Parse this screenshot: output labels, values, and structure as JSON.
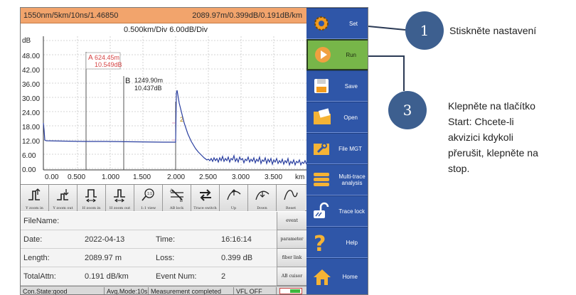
{
  "header": {
    "params_left": "1550nm/5km/10ns/1.46850",
    "params_right": "2089.97m/0.399dB/0.191dB/km"
  },
  "plot": {
    "y_unit": "dB",
    "scale_text": "0.500km/Div  6.00dB/Div",
    "y_ticks": [
      "48.00",
      "42.00",
      "36.00",
      "30.00",
      "24.00",
      "18.00",
      "12.00",
      "6.00",
      "0.00"
    ],
    "x_ticks": [
      "0.00",
      "0.500",
      "1.000",
      "1.500",
      "2.000",
      "2.500",
      "3.000",
      "3.500"
    ],
    "x_unit": "km",
    "marker_a_letter": "A",
    "marker_a_distance": "624.45m",
    "marker_a_loss": "10.549dB",
    "marker_b_letter": "B",
    "marker_b_distance": "1249.90m",
    "marker_b_loss": "10.437dB",
    "event_number": "2",
    "colors": {
      "trace": "#2a3fa0",
      "marker_a": "#d64545",
      "event": "#e0a0c0"
    }
  },
  "toolbar": {
    "tools": [
      {
        "label": "Y zoom in",
        "icon": "y-zoom-in-icon"
      },
      {
        "label": "Y zoom out",
        "icon": "y-zoom-out-icon"
      },
      {
        "label": "H zoom in",
        "icon": "h-zoom-in-icon"
      },
      {
        "label": "H zoom out",
        "icon": "h-zoom-out-icon"
      },
      {
        "label": "1:1 view",
        "icon": "one-to-one-view-icon"
      },
      {
        "label": "AB lock",
        "icon": "ab-lock-icon"
      },
      {
        "label": "Trace switch",
        "icon": "trace-switch-icon"
      },
      {
        "label": "Up",
        "icon": "up-icon"
      },
      {
        "label": "Down",
        "icon": "down-icon"
      },
      {
        "label": "Reset",
        "icon": "reset-icon"
      }
    ]
  },
  "info": {
    "filename_label": "FileName:",
    "filename_value": "",
    "date_label": "Date:",
    "date_value": "2022-04-13",
    "time_label": "Time:",
    "time_value": "16:16:14",
    "length_label": "Length:",
    "length_value": "2089.97 m",
    "loss_label": "Loss:",
    "loss_value": "0.399 dB",
    "attn_label": "TotalAttn:",
    "attn_value": "0.191 dB/km",
    "events_label": "Event Num:",
    "events_value": "2"
  },
  "side_tabs": [
    "event",
    "parameter",
    "fiber link",
    "AB cuisor"
  ],
  "status": {
    "connection": "Con.State:good",
    "avg_mode": "Avg.Mode:10s",
    "measurement": "Measurement completed",
    "vfl": "VFL OFF"
  },
  "menu": {
    "items": [
      {
        "label": "Set",
        "icon": "gear-icon"
      },
      {
        "label": "Run",
        "icon": "play-icon"
      },
      {
        "label": "Save",
        "icon": "floppy-disk-icon"
      },
      {
        "label": "Open",
        "icon": "folder-icon"
      },
      {
        "label": "File MGT",
        "icon": "wrench-icon"
      },
      {
        "label": "Multi-trace analysis",
        "icon": "multi-trace-icon"
      },
      {
        "label": "Trace lock",
        "icon": "lock-icon"
      },
      {
        "label": "Help",
        "icon": "question-icon"
      },
      {
        "label": "Home",
        "icon": "home-icon"
      }
    ],
    "accent_color": "#2f56a8",
    "active_color": "#77b649"
  },
  "callouts": {
    "step1_number": "1",
    "step1_text": "Stiskněte nastavení",
    "step3_number": "3",
    "step3_line1": "Klepněte na tlačítko",
    "step3_line2": "Start: Chcete-li",
    "step3_line3": "akvizici kdykoli",
    "step3_line4": "přerušit, klepněte na",
    "step3_line5": "stop."
  }
}
